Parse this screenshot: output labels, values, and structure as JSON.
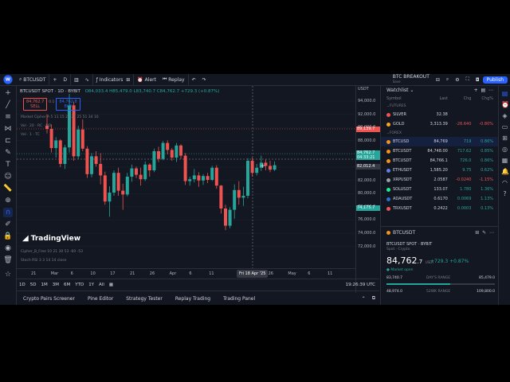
{
  "topbar": {
    "logo": "W",
    "symbol": "BTCUSDT",
    "interval": "D",
    "indicators_label": "Indicators",
    "alert_label": "Alert",
    "replay_label": "Replay",
    "layout_name": "BTC BREAKOUT",
    "layout_sub": "Save",
    "publish_label": "Publish"
  },
  "chart": {
    "title": "BTCUSDT SPOT · 1D · BYBIT",
    "ohlc": "O84,033.4 H85,479.0 L83,740.7 C84,762.7 +729.3 (+0.87%)",
    "sell_price": "84,762.7",
    "sell_label": "SELL",
    "buy_price": "84,762.8",
    "buy_label": "BUY",
    "spread": "0.1",
    "indicator_lines": [
      "Market Cipher A 5 11 15 20 21 25 51 34 10",
      "Vol · 20 · RC · NO",
      "Vol · 1 · TC"
    ],
    "bottom_indicators": [
      "Cipher_B_Free 10 21 30 53 -60 -53",
      "Stoch RSI 3 3 14 14 close"
    ],
    "tv_logo": "TradingView",
    "currency": "USDT",
    "y_ticks": [
      "94,000.0",
      "92,000.0",
      "90,000.0",
      "88,000.0",
      "86,000.0",
      "84,000.0",
      "82,000.0",
      "80,000.0",
      "78,000.0",
      "76,000.0",
      "74,000.0",
      "72,000.0"
    ],
    "y_labels": {
      "red": "89,139.7",
      "green": "84,762.7",
      "green_sub": "04:33:21",
      "cross": "82,012.4",
      "low": "74,175.7"
    },
    "x_ticks": [
      "21",
      "Mar",
      "6",
      "10",
      "17",
      "21",
      "26",
      "Apr",
      "6",
      "11",
      "",
      "18",
      "26",
      "May",
      "6",
      "11"
    ],
    "x_hover": "Fri 18 Apr '25"
  },
  "range": {
    "items": [
      "1D",
      "5D",
      "1M",
      "3M",
      "6M",
      "YTD",
      "1Y",
      "All"
    ],
    "time": "19:26:39 UTC"
  },
  "bottombar": {
    "items": [
      "Crypto Pairs Screener",
      "Pine Editor",
      "Strategy Tester",
      "Replay Trading",
      "Trading Panel"
    ]
  },
  "watchlist": {
    "title": "Watchlist",
    "cols": [
      "Symbol",
      "Last",
      "Chg",
      "Chg%"
    ],
    "sections": {
      "futures": "FUTURES",
      "forex": "FOREX"
    },
    "rows_top": [
      {
        "sym": "SILVER",
        "last": "32.38",
        "chg": "",
        "pct": "",
        "color": "#ef5350",
        "dir": "dn"
      },
      {
        "sym": "GOLD",
        "last": "3,313.39",
        "chg": "-26.640",
        "pct": "-0.80%",
        "color": "#f5a623",
        "dir": "dn"
      }
    ],
    "rows": [
      {
        "sym": "BTCUSD",
        "last": "84,769",
        "chg": "719",
        "pct": "0.86%",
        "color": "#f7931a",
        "dir": "up"
      },
      {
        "sym": "BTCUSDT",
        "last": "84,748.00",
        "chg": "717.62",
        "pct": "0.85%",
        "color": "#f7931a",
        "dir": "up"
      },
      {
        "sym": "BTCUSDT",
        "last": "84,766.1",
        "chg": "726.0",
        "pct": "0.86%",
        "color": "#f7931a",
        "dir": "up"
      },
      {
        "sym": "ETHUSDT",
        "last": "1,585.20",
        "chg": "9.75",
        "pct": "0.62%",
        "color": "#627eea",
        "dir": "up"
      },
      {
        "sym": "XRPUSDT",
        "last": "2.0587",
        "chg": "-0.0240",
        "pct": "-1.15%",
        "color": "#9aa0a6",
        "dir": "dn"
      },
      {
        "sym": "SOLUSDT",
        "last": "133.07",
        "chg": "1.780",
        "pct": "1.36%",
        "color": "#14f195",
        "dir": "up"
      },
      {
        "sym": "ADAUSDT",
        "last": "0.6170",
        "chg": "0.0069",
        "pct": "1.13%",
        "color": "#2a71d0",
        "dir": "up"
      },
      {
        "sym": "TRXUSDT",
        "last": "0.2422",
        "chg": "0.0003",
        "pct": "0.13%",
        "color": "#ef5350",
        "dir": "up"
      }
    ]
  },
  "details": {
    "symbol": "BTCUSDT",
    "name": "BTCUSDT SPOT · BYBIT",
    "sub": "Spot · Crypto",
    "price_main": "84,762",
    "price_dec": ".7",
    "currency": "USDT",
    "change": "+729.3 +0.87%",
    "status": "● Market open",
    "day_low": "83,740.7",
    "day_label": "DAY'S RANGE",
    "day_high": "85,479.0",
    "day_fill": 0.59,
    "yr_low": "48,974.0",
    "yr_label": "52WK RANGE",
    "yr_high": "109,800.0",
    "yr_fill": 0.59
  },
  "chart_data": {
    "type": "candlestick",
    "y_range": [
      71000,
      96000
    ],
    "candles": [
      [
        91000,
        92800,
        89800,
        90500
      ],
      [
        90500,
        91200,
        86800,
        87500
      ],
      [
        87500,
        89200,
        86000,
        88700
      ],
      [
        88700,
        88900,
        84500,
        85000
      ],
      [
        85000,
        88000,
        84200,
        87600
      ],
      [
        87600,
        96000,
        86800,
        94200
      ],
      [
        94200,
        94800,
        85500,
        86200
      ],
      [
        86200,
        91000,
        85800,
        90400
      ],
      [
        90400,
        92000,
        87000,
        87400
      ],
      [
        87400,
        87800,
        82800,
        83400
      ],
      [
        83400,
        86700,
        82900,
        86200
      ],
      [
        86200,
        87000,
        84600,
        85000
      ],
      [
        85000,
        86700,
        81800,
        83200
      ],
      [
        83200,
        83800,
        78600,
        79100
      ],
      [
        79100,
        81500,
        76700,
        80500
      ],
      [
        80500,
        84000,
        80000,
        83600
      ],
      [
        83600,
        84400,
        80000,
        80800
      ],
      [
        80800,
        81900,
        77800,
        80200
      ],
      [
        80200,
        83600,
        79900,
        83000
      ],
      [
        83000,
        84900,
        82200,
        84300
      ],
      [
        84300,
        84600,
        82800,
        83300
      ],
      [
        83300,
        84400,
        81600,
        82600
      ],
      [
        82600,
        85400,
        82300,
        84900
      ],
      [
        84900,
        85100,
        83000,
        84000
      ],
      [
        84000,
        87400,
        83700,
        87000
      ],
      [
        87000,
        87700,
        85300,
        85800
      ],
      [
        85800,
        88600,
        85600,
        88300
      ],
      [
        88300,
        88700,
        86500,
        87200
      ],
      [
        87200,
        87500,
        85500,
        86000
      ],
      [
        86000,
        88300,
        85300,
        87900
      ],
      [
        87900,
        88100,
        85800,
        86300
      ],
      [
        86300,
        86700,
        81700,
        82300
      ],
      [
        82300,
        83000,
        81600,
        82600
      ],
      [
        82600,
        84200,
        82100,
        83200
      ],
      [
        83200,
        83700,
        81400,
        82400
      ],
      [
        82400,
        83400,
        81700,
        83100
      ],
      [
        83100,
        83600,
        82000,
        82500
      ],
      [
        82500,
        84700,
        82300,
        84400
      ],
      [
        84400,
        84800,
        81100,
        81600
      ],
      [
        81600,
        81700,
        77200,
        78000
      ],
      [
        78000,
        78600,
        74600,
        75300
      ],
      [
        75300,
        78200,
        74900,
        77800
      ],
      [
        77800,
        81800,
        76400,
        80900
      ],
      [
        80900,
        82300,
        78600,
        79700
      ],
      [
        79700,
        81400,
        78400,
        80000
      ],
      [
        80000,
        85900,
        79600,
        85500
      ],
      [
        85500,
        86000,
        83000,
        83600
      ],
      [
        83600,
        85000,
        83200,
        84400
      ],
      [
        84400,
        86300,
        83900,
        85200
      ],
      [
        85200,
        85700,
        84000,
        84700
      ],
      [
        84700,
        85500,
        83700,
        84100
      ],
      [
        84100,
        85400,
        83900,
        84800
      ]
    ]
  }
}
